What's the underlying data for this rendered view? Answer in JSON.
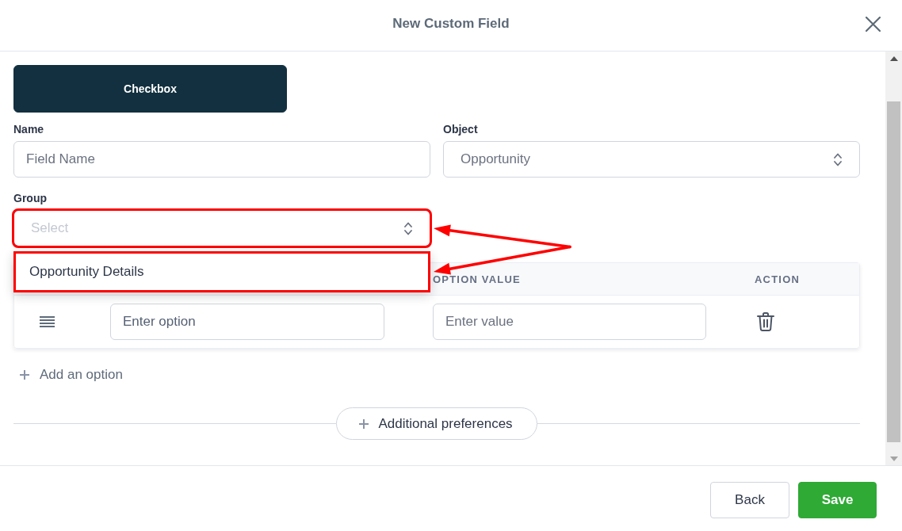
{
  "dialog": {
    "title": "New Custom Field"
  },
  "field_types": [
    {
      "label": "Checkbox",
      "selected": true
    }
  ],
  "form": {
    "name": {
      "label": "Name",
      "placeholder": "Field Name"
    },
    "object": {
      "label": "Object",
      "value": "Opportunity"
    },
    "group": {
      "label": "Group",
      "placeholder": "Select",
      "expanded": true,
      "highlighted": true,
      "options": [
        {
          "label": "Opportunity Details",
          "selected": false,
          "highlighted": true
        }
      ]
    }
  },
  "options_table": {
    "columns": [
      "OPTION VALUE",
      "ACTION"
    ],
    "rows": [
      {
        "option_placeholder": "Enter option",
        "value_placeholder": "Enter value"
      }
    ]
  },
  "add_option": "Add an option",
  "preferences_button": "Additional preferences",
  "footer": {
    "buttons": [
      {
        "label": "Back",
        "kind": "secondary"
      },
      {
        "label": "Save",
        "kind": "primary"
      }
    ]
  }
}
